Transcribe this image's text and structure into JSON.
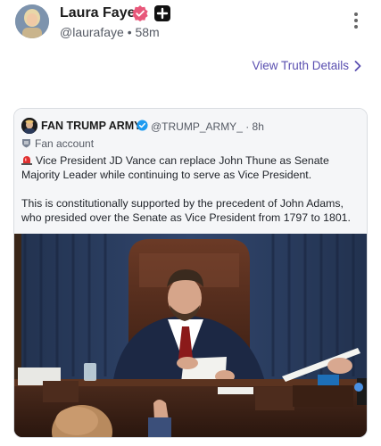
{
  "post": {
    "author_name": "Laura Faye",
    "author_handle": "@laurafaye",
    "timestamp": "58m",
    "handle_line": "@laurafaye • 58m",
    "view_details_label": "View Truth Details"
  },
  "embed": {
    "author_name": "FAN TRUMP ARMY",
    "author_handle": "@TRUMP_ARMY_",
    "timestamp": "8h",
    "handle_line": "@TRUMP_ARMY_ · 8h",
    "account_label": "Fan account",
    "text_p1": "Vice President JD Vance can replace John Thune as Senate Majority Leader while continuing to serve as Vice President.",
    "text_p2": "This is constitutionally supported by the precedent of John Adams, who presided over the Senate as Vice President from 1797 to 1801."
  },
  "icons": {
    "verified": "verified-badge-icon",
    "plus": "plus-badge-icon",
    "more": "more-vertical-icon",
    "chevron": "chevron-right-icon",
    "fan": "fan-account-icon",
    "siren": "siren-emoji-icon"
  },
  "colors": {
    "accent": "#5a4fb0",
    "verified_pink": "#e8577a",
    "check_blue": "#1d9bf0",
    "curtain_blue": "#2c3f63"
  }
}
